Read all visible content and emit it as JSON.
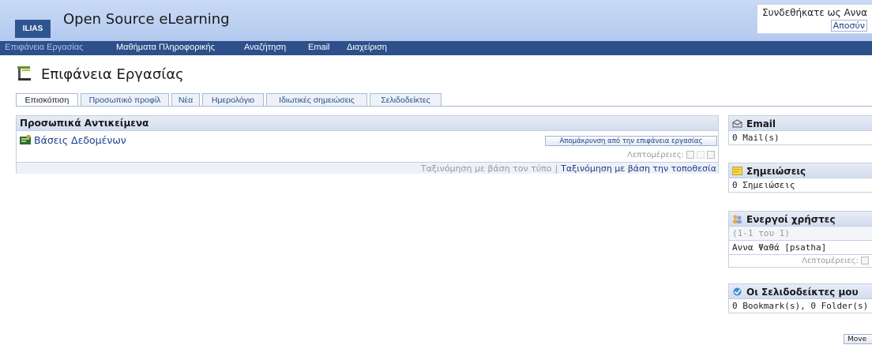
{
  "header": {
    "logo_text": "ILIAS",
    "site_title": "Open Source eLearning",
    "login_text": "Συνδεθήκατε ως Αννα",
    "logout_label": "Αποσύν"
  },
  "nav": {
    "items": [
      {
        "label": "Επιφάνεια Εργασίας"
      },
      {
        "label": "Μαθήματα Πληροφορικής"
      },
      {
        "label": "Αναζήτηση"
      },
      {
        "label": "Email"
      },
      {
        "label": "Διαχείριση"
      }
    ]
  },
  "page": {
    "title": "Επιφάνεια Εργασίας",
    "tabs": [
      {
        "label": "Επισκόπιση"
      },
      {
        "label": "Προσωπικό προφίλ"
      },
      {
        "label": "Νέα"
      },
      {
        "label": "Ημερολόγιο"
      },
      {
        "label": "Ιδιωτικές σημειώσεις"
      },
      {
        "label": "Σελιδοδείκτες"
      }
    ]
  },
  "personal_items": {
    "title": "Προσωπικά Αντικείμενα",
    "item_label": "Βάσεις Δεδομένων",
    "remove_button": "Απομάκρυνση από την επιφάνεια εργασίας",
    "details_label": "Λεπτομέρειες:",
    "sort_by_type": "Ταξινόμηση με βάση τον τύπο",
    "sort_separator": "|",
    "sort_by_location": "Ταξινόμηση με βάση την τοποθεσία"
  },
  "sidebar": {
    "email": {
      "title": "Email",
      "value": "0 Mail(s)"
    },
    "notes": {
      "title": "Σημειώσεις",
      "value": "0 Σημειώσεις"
    },
    "users": {
      "title": "Ενεργοί χρήστες",
      "range": "(1-1 του 1)",
      "user": "Αννα Ψαθά [psatha]",
      "details_label": "Λεπτομέρειες:"
    },
    "bookmarks": {
      "title": "Οι Σελιδοδείκτες μου",
      "value": "0 Bookmark(s), 0 Folder(s)"
    }
  },
  "move_button": "Move",
  "colors": {
    "header_bg": "#c9daf6",
    "nav_bg": "#2d4f8a",
    "link": "#1a3e8c"
  }
}
